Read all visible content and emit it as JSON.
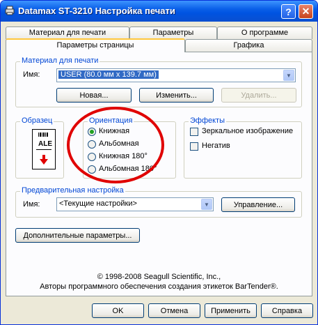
{
  "window": {
    "title": "Datamax ST-3210 Настройка печати",
    "help_label": "?",
    "close_label": "✕"
  },
  "tabs_row1": [
    "Материал для печати",
    "Параметры",
    "О программе"
  ],
  "tabs_row2": [
    "Параметры страницы",
    "Графика"
  ],
  "media": {
    "group_label": "Материал для печати",
    "name_label": "Имя:",
    "name_value": "USER (80.0 мм x 139.7 мм)",
    "new_button": "Новая...",
    "edit_button": "Изменить...",
    "delete_button": "Удалить..."
  },
  "preview": {
    "group_label": "Образец",
    "sample_text": "ALE"
  },
  "orientation": {
    "group_label": "Ориентация",
    "options": [
      "Книжная",
      "Альбомная",
      "Книжная 180°",
      "Альбомная 180°"
    ],
    "selected": "Книжная"
  },
  "effects": {
    "group_label": "Эффекты",
    "mirror": "Зеркальное изображение",
    "negative": "Негатив"
  },
  "preset": {
    "group_label": "Предварительная настройка",
    "name_label": "Имя:",
    "name_value": "<Текущие настройки>",
    "manage_button": "Управление..."
  },
  "advanced_button": "Дополнительные параметры...",
  "copyright": {
    "line1": "© 1998-2008 Seagull Scientific, Inc.,",
    "line2": "Авторы программного обеспечения создания этикеток BarTender®."
  },
  "footer": {
    "ok": "OK",
    "cancel": "Отмена",
    "apply": "Применить",
    "help": "Справка"
  },
  "colors": {
    "group_label": "#0046d5",
    "title_bar": "#0053e1",
    "annotation_circle": "#e00000",
    "radio_dot": "#21a121"
  }
}
